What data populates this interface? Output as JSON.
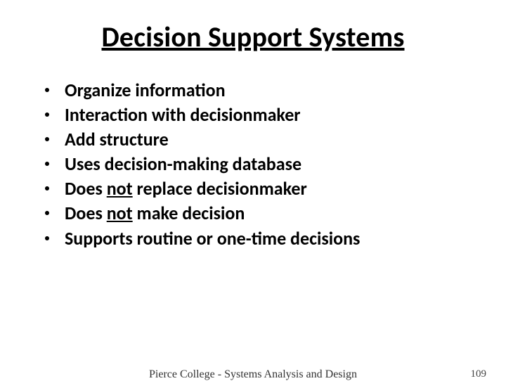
{
  "title": "Decision Support Systems",
  "bullets": [
    {
      "pre": "Organize information",
      "u": "",
      "post": ""
    },
    {
      "pre": "Interaction with decisionmaker",
      "u": "",
      "post": ""
    },
    {
      "pre": "Add structure",
      "u": "",
      "post": ""
    },
    {
      "pre": "Uses decision-making database",
      "u": "",
      "post": ""
    },
    {
      "pre": "Does ",
      "u": "not",
      "post": " replace decisionmaker"
    },
    {
      "pre": "Does ",
      "u": "not",
      "post": "  make decision"
    },
    {
      "pre": "Supports routine or one-time decisions",
      "u": "",
      "post": ""
    }
  ],
  "footer": {
    "center": "Pierce College - Systems Analysis and Design",
    "page": "109"
  }
}
